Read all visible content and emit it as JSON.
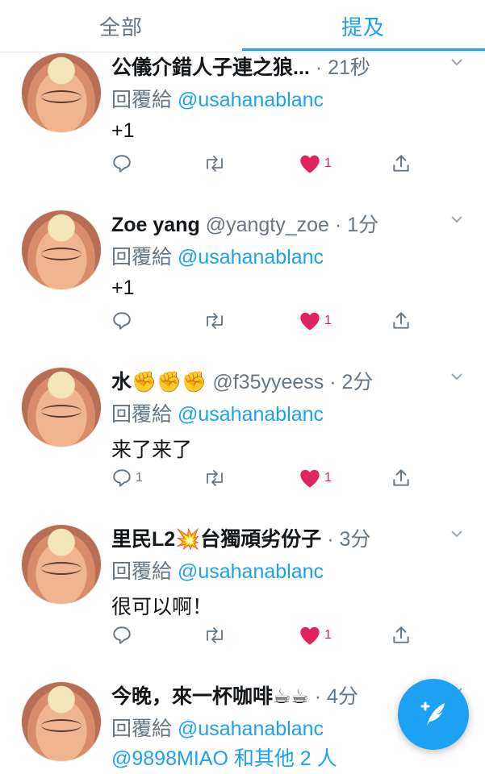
{
  "tabs": {
    "all": "全部",
    "mentions": "提及",
    "active": "mentions"
  },
  "colors": {
    "accent": "#1da1f2",
    "like": "#e0245e",
    "muted": "#657786",
    "text": "#14171a"
  },
  "tweets": [
    {
      "display_name": "公儀介錯人子連之狼...",
      "handle": "",
      "time": "· 21秒",
      "reply_prefix": "回覆給",
      "reply_to": "@usahanablanc",
      "text": "+1",
      "reply_count": "",
      "like_count": "1"
    },
    {
      "display_name": "Zoe yang",
      "handle": "@yangty_zoe",
      "time": "· 1分",
      "reply_prefix": "回覆給",
      "reply_to": "@usahanablanc",
      "text": "+1",
      "reply_count": "",
      "like_count": "1"
    },
    {
      "display_name": "水✊✊✊",
      "handle": "@f35yyeess",
      "time": "· 2分",
      "reply_prefix": "回覆給",
      "reply_to": "@usahanablanc",
      "text": "来了来了",
      "reply_count": "1",
      "like_count": "1"
    },
    {
      "display_name": "里民L2💥台獨頑劣份子",
      "handle": "",
      "time": "· 3分",
      "reply_prefix": "回覆給",
      "reply_to": "@usahanablanc",
      "text": "很可以啊！",
      "reply_count": "",
      "like_count": "1"
    },
    {
      "display_name": "今晚，來一杯咖啡☕☕",
      "handle": "",
      "time": "· 4分",
      "reply_prefix": "回覆給",
      "reply_to": "@usahanablanc",
      "text": "@9898MIAO 和其他 2 人",
      "reply_count": "",
      "like_count": ""
    }
  ],
  "icons": {
    "reply": "reply-icon",
    "retweet": "retweet-icon",
    "like": "heart-icon",
    "share": "share-icon",
    "more": "chevron-down-icon",
    "compose": "compose-tweet-icon"
  }
}
